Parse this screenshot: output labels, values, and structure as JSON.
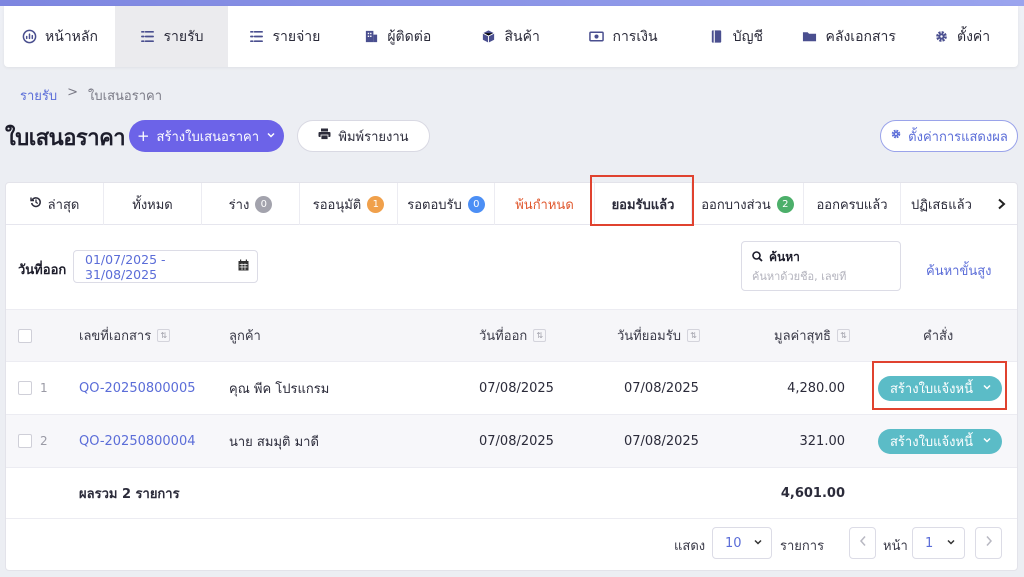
{
  "nav": {
    "items": [
      {
        "label": "หน้าหลัก",
        "icon": "dashboard-icon"
      },
      {
        "label": "รายรับ",
        "icon": "income-list-icon"
      },
      {
        "label": "รายจ่าย",
        "icon": "expense-list-icon"
      },
      {
        "label": "ผู้ติดต่อ",
        "icon": "contacts-building-icon"
      },
      {
        "label": "สินค้า",
        "icon": "product-box-icon"
      },
      {
        "label": "การเงิน",
        "icon": "money-icon"
      },
      {
        "label": "บัญชี",
        "icon": "ledger-book-icon"
      },
      {
        "label": "คลังเอกสาร",
        "icon": "folder-icon"
      },
      {
        "label": "ตั้งค่า",
        "icon": "gear-icon"
      }
    ],
    "active_index": 1
  },
  "breadcrumb": {
    "root": "รายรับ",
    "separator": ">",
    "current": "ใบเสนอราคา"
  },
  "header": {
    "title": "ใบเสนอราคา",
    "create_label": "สร้างใบเสนอราคา",
    "print_label": "พิมพ์รายงาน",
    "settings_label": "ตั้งค่าการแสดงผล"
  },
  "tabs": [
    {
      "label": "ล่าสุด"
    },
    {
      "label": "ทั้งหมด"
    },
    {
      "label": "ร่าง",
      "badge": "0",
      "badge_color": "#a3a3ad"
    },
    {
      "label": "รออนุมัติ",
      "badge": "1",
      "badge_color": "#f0a04b"
    },
    {
      "label": "รอตอบรับ",
      "badge": "0",
      "badge_color": "#4c8ff5"
    },
    {
      "label": "พ้นกำหนด"
    },
    {
      "label": "ยอมรับแล้ว"
    },
    {
      "label": "ออกบางส่วน",
      "badge": "2",
      "badge_color": "#4caf6a"
    },
    {
      "label": "ออกครบแล้ว"
    },
    {
      "label": "ปฏิเสธแล้ว"
    }
  ],
  "filters": {
    "date_label": "วันที่ออก",
    "date_range": "01/07/2025 - 31/08/2025",
    "search_label": "ค้นหา",
    "search_placeholder": "ค้นหาด้วยชื่อ, เลขที่",
    "advanced_label": "ค้นหาขั้นสูง"
  },
  "table": {
    "columns": {
      "doc_no": "เลขที่เอกสาร",
      "customer": "ลูกค้า",
      "issue_date": "วันที่ออก",
      "accept_date": "วันที่ยอมรับ",
      "net": "มูลค่าสุทธิ",
      "action": "คำสั่ง"
    },
    "rows": [
      {
        "num": "1",
        "doc_no": "QO-20250800005",
        "customer": "คุณ พีค โปรแกรม",
        "issue_date": "07/08/2025",
        "accept_date": "07/08/2025",
        "net": "4,280.00",
        "action": "สร้างใบแจ้งหนี้"
      },
      {
        "num": "2",
        "doc_no": "QO-20250800004",
        "customer": "นาย สมมุติ มาดี",
        "issue_date": "07/08/2025",
        "accept_date": "07/08/2025",
        "net": "321.00",
        "action": "สร้างใบแจ้งหนี้"
      }
    ],
    "summary": {
      "label": "ผลรวม 2 รายการ",
      "total": "4,601.00"
    }
  },
  "pagination": {
    "show_label": "แสดง",
    "page_size": "10",
    "items_label": "รายการ",
    "page_label": "หน้า",
    "page": "1"
  },
  "colors": {
    "accent": "#6c63e8",
    "link": "#5b6dd8",
    "teal_button": "#5bbcc7",
    "highlight": "#e0422f"
  }
}
